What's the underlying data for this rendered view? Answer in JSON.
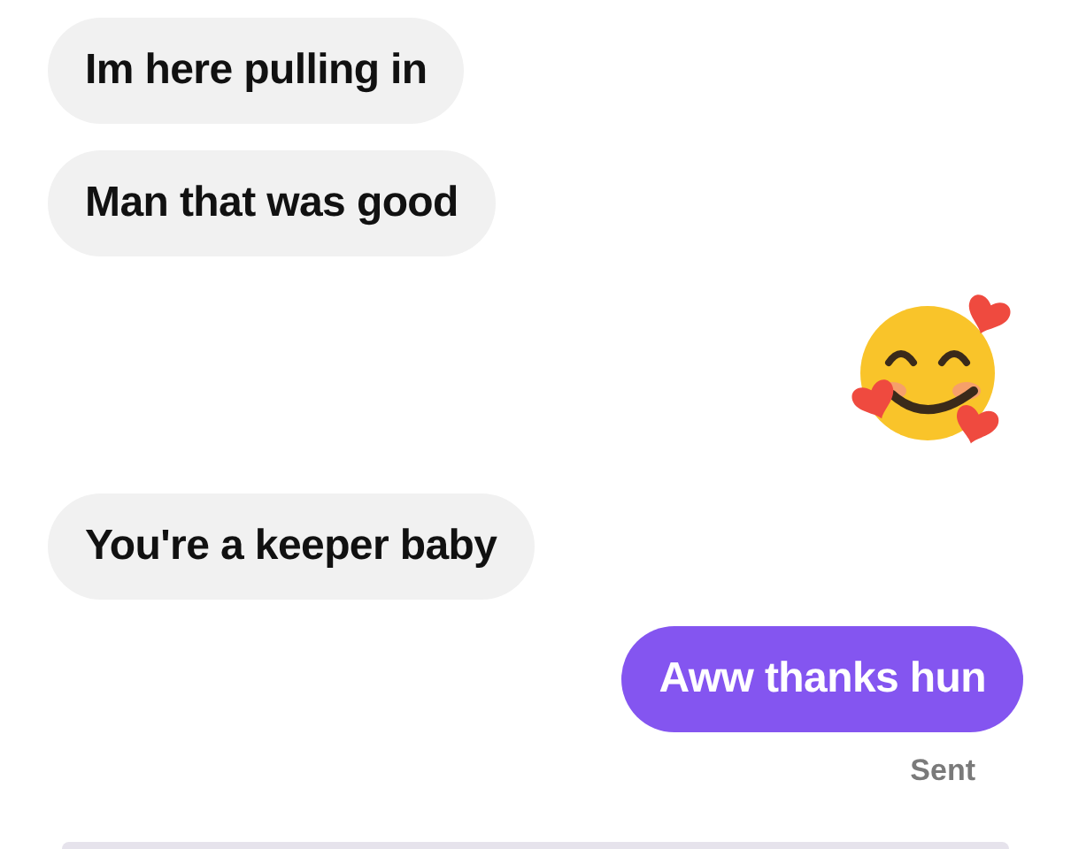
{
  "messages": [
    {
      "kind": "received",
      "text": "Im here pulling in"
    },
    {
      "kind": "received",
      "text": "Man that was good"
    },
    {
      "kind": "emoji"
    },
    {
      "kind": "received",
      "text": "You're a keeper baby"
    },
    {
      "kind": "sent",
      "text": "Aww thanks hun",
      "status": "Sent"
    }
  ]
}
